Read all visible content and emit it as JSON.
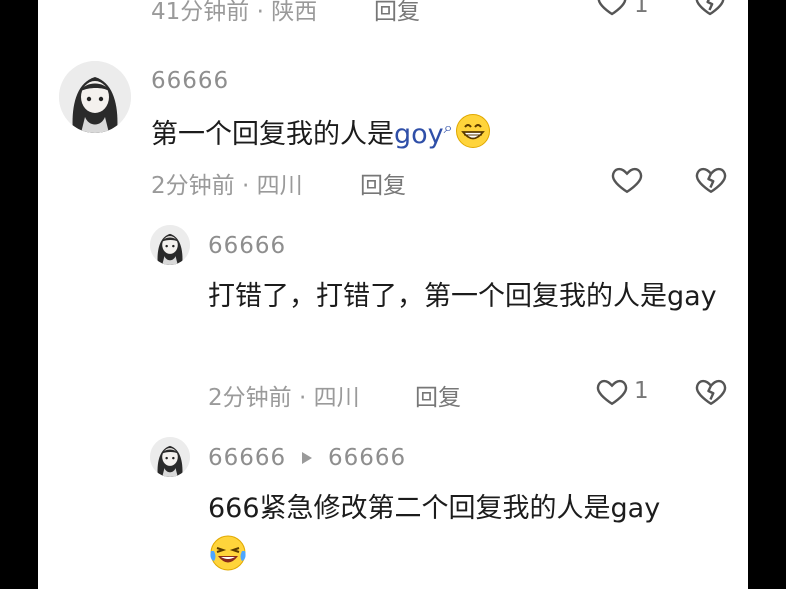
{
  "top_comment": {
    "meta": "41分钟前 · 陕西",
    "reply_label": "回复",
    "like_count": "1"
  },
  "comment_1": {
    "username": "66666",
    "text_prefix": "第一个回复我的人是",
    "text_keyword": "goy",
    "keyword_icon": "search-icon",
    "emoji": "grinning-face-emoji",
    "meta": "2分钟前 · 四川",
    "reply_label": "回复"
  },
  "reply_1": {
    "username": "66666",
    "text": "打错了，打错了，第一个回复我的人是gay",
    "meta": "2分钟前 · 四川",
    "reply_label": "回复",
    "like_count": "1"
  },
  "reply_2": {
    "username": "66666",
    "reply_to": "66666",
    "text": "666紧急修改第二个回复我的人是gay",
    "emoji": "laughing-crying-face-emoji"
  },
  "colors": {
    "background": "#ffffff",
    "side_bars": "#000000",
    "text": "#1c1c1c",
    "meta": "#9a9a9a",
    "keyword_link": "#2f4fa8"
  }
}
